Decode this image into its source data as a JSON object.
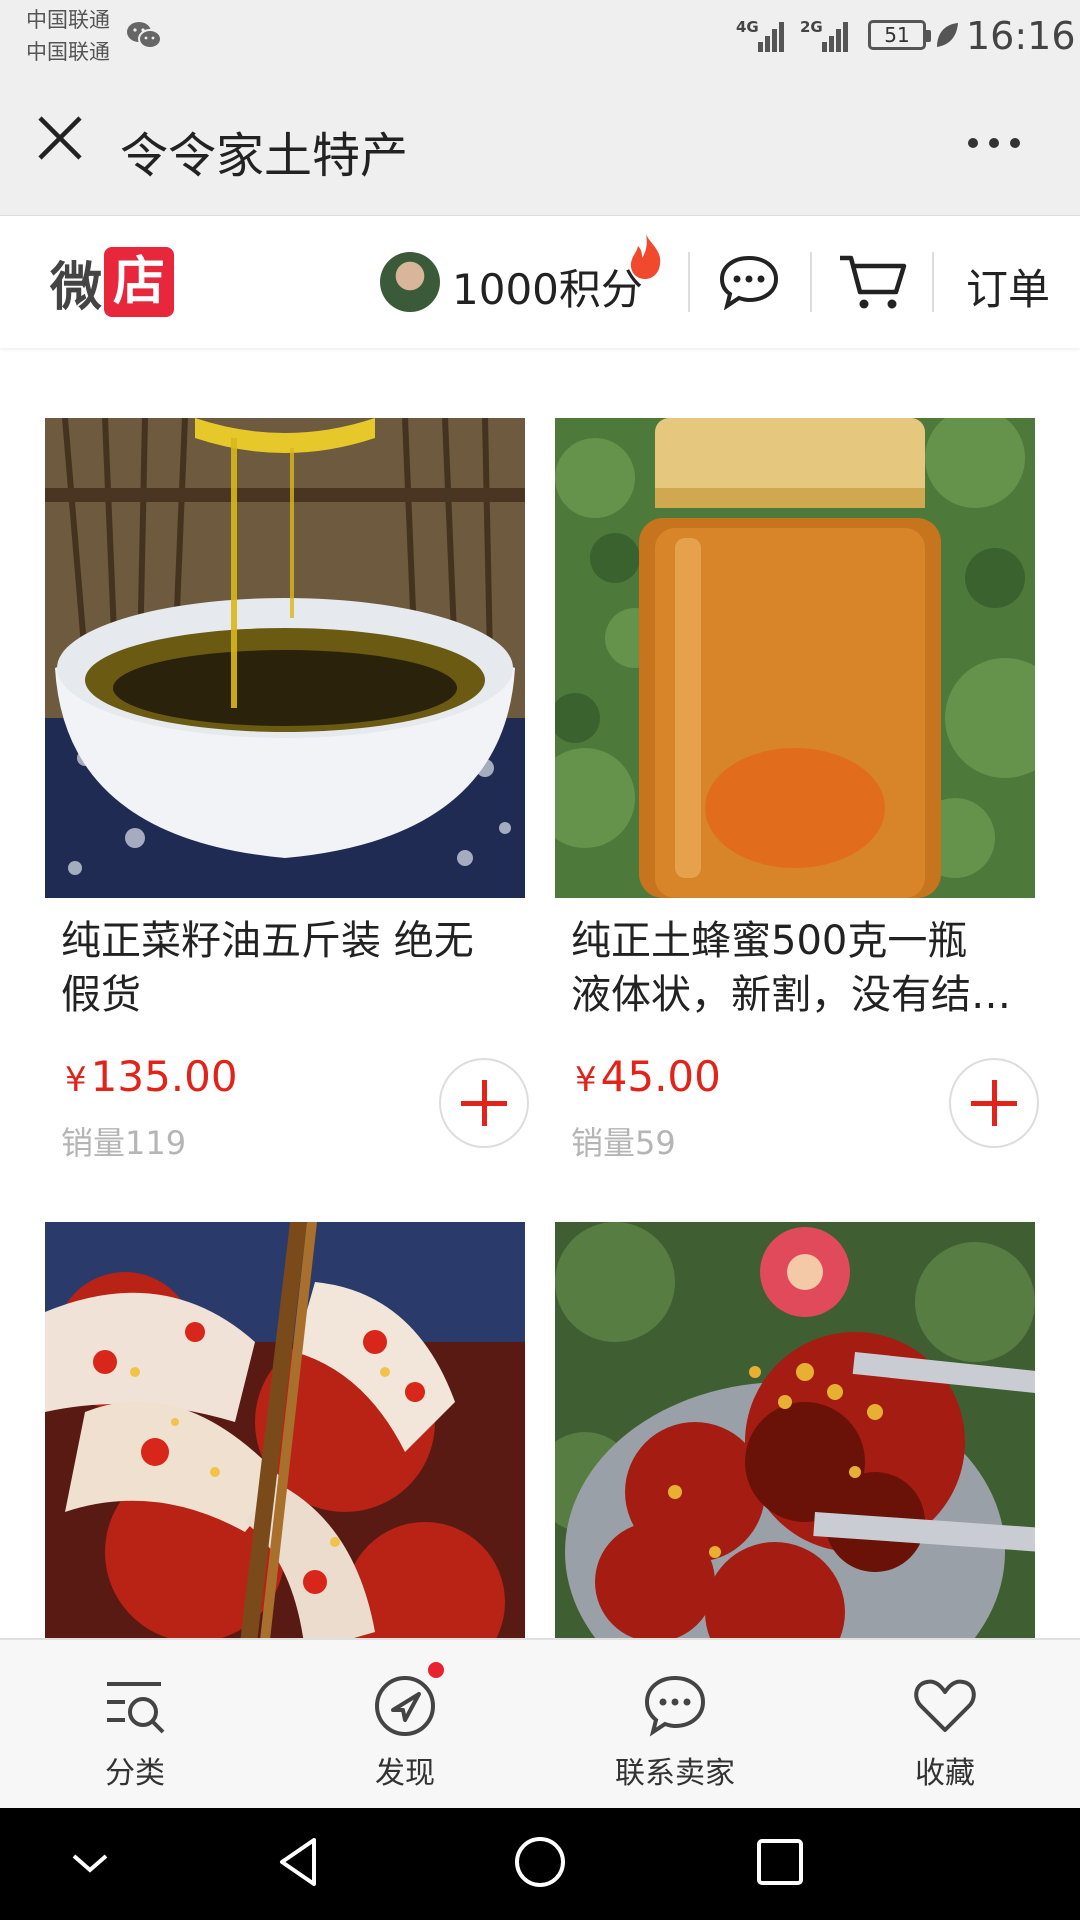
{
  "status_bar": {
    "carrier_1": "中国联通",
    "carrier_2": "中国联通",
    "network_1": "4G",
    "network_2": "2G",
    "battery": "51",
    "time": "16:16"
  },
  "title_bar": {
    "title": "令令家土特产"
  },
  "shop_header": {
    "logo_text_1": "微",
    "logo_text_2": "店",
    "points": "1000积分",
    "orders_label": "订单"
  },
  "products": [
    {
      "name": "纯正菜籽油五斤装 绝无假货",
      "currency": "¥",
      "price": "135.00",
      "sales": "销量119",
      "image": "rapeseed-oil-bowl"
    },
    {
      "name": "纯正土蜂蜜500克一瓶 液体状，新割，没有结…",
      "currency": "¥",
      "price": "45.00",
      "sales": "销量59",
      "image": "honey-jar"
    },
    {
      "image": "pickled-radish-chili"
    },
    {
      "image": "chili-sauce-chopsticks"
    }
  ],
  "bottom_nav": [
    {
      "label": "分类",
      "icon": "category-search-icon"
    },
    {
      "label": "发现",
      "icon": "compass-icon",
      "badge": true
    },
    {
      "label": "联系卖家",
      "icon": "chat-icon"
    },
    {
      "label": "收藏",
      "icon": "heart-icon"
    }
  ],
  "colors": {
    "accent": "#e2231a",
    "logo_red": "#e8273c",
    "muted": "#b5b5b5"
  }
}
